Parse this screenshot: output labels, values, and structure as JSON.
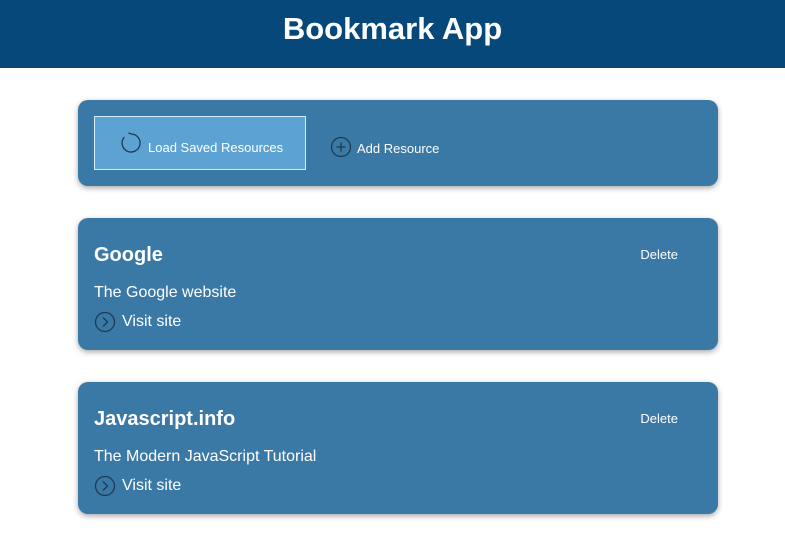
{
  "header": {
    "title": "Bookmark App"
  },
  "toolbar": {
    "load_label": "Load Saved Resources",
    "add_label": "Add Resource"
  },
  "resources": [
    {
      "title": "Google",
      "description": "The Google website",
      "delete_label": "Delete",
      "visit_label": "Visit site"
    },
    {
      "title": "Javascript.info",
      "description": "The Modern JavaScript Tutorial",
      "delete_label": "Delete",
      "visit_label": "Visit site"
    }
  ],
  "colors": {
    "header_bg": "#06487a",
    "panel_bg": "#3a78a6",
    "button_bg": "#5ca3d4",
    "text": "#ffffff"
  },
  "icons": {
    "load": "refresh-icon",
    "add": "plus-circle-icon",
    "visit": "chevron-right-circle-icon"
  }
}
